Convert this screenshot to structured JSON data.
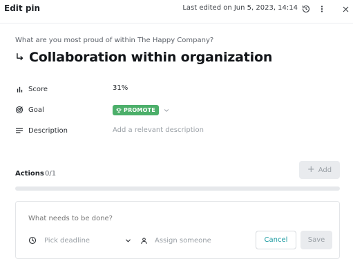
{
  "header": {
    "title": "Edit pin",
    "last_edited": "Last edited on Jun 5, 2023, 14:14",
    "icons": [
      "history-icon",
      "more-vertical-icon",
      "close-icon"
    ]
  },
  "pin": {
    "question": "What are you most proud of within The Happy Company?",
    "title": "Collaboration within organization",
    "title_icon": "subdirectory-arrow-icon"
  },
  "fields": {
    "score": {
      "label": "Score",
      "value": "31%",
      "icon": "bar-chart-icon"
    },
    "goal": {
      "label": "Goal",
      "badge": "PROMOTE",
      "badge_icon": "trophy-icon",
      "badge_color": "#4caf6a",
      "icon": "target-icon"
    },
    "description": {
      "label": "Description",
      "placeholder": "Add a relevant description",
      "icon": "lines-icon"
    }
  },
  "actions": {
    "title": "Actions",
    "count": "0/1",
    "progress": 0,
    "add_label": "Add"
  },
  "task": {
    "placeholder": "What needs to be done?",
    "deadline_placeholder": "Pick deadline",
    "assign_placeholder": "Assign someone",
    "cancel_label": "Cancel",
    "save_label": "Save",
    "accent_color": "#1a9aa0"
  }
}
